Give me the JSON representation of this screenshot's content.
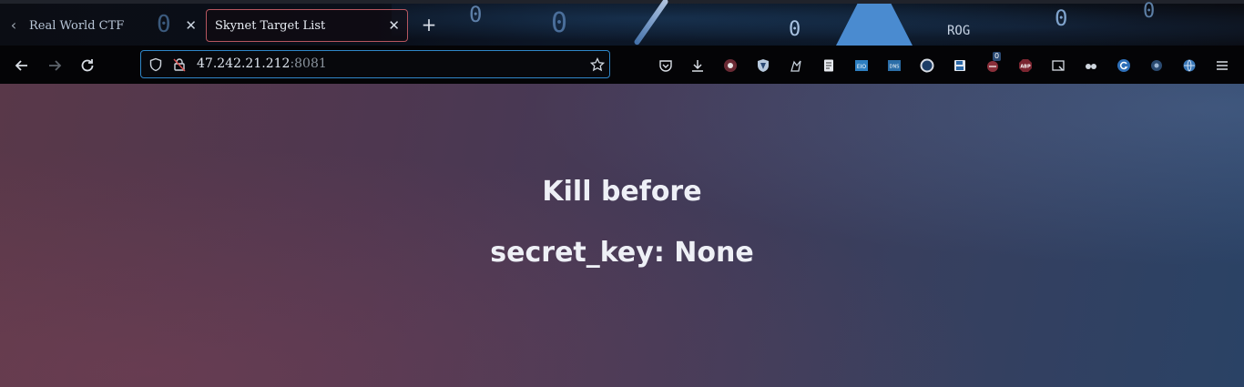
{
  "browser": {
    "tabs": [
      {
        "title": "Real World CTF",
        "active": false
      },
      {
        "title": "Skynet Target List",
        "active": true
      }
    ],
    "url": {
      "host": "47.242.21.212",
      "port": ":8081"
    },
    "toolbar_icons": [
      "pocket-icon",
      "download-icon",
      "extension-icon",
      "shield-extension-icon",
      "robot-extension-icon",
      "reader-extension-icon",
      "cookie-editor-icon",
      "dns-extension-icon",
      "circle-extension-icon",
      "save-extension-icon",
      "hackbar-icon",
      "adblock-plus-icon",
      "screenshot-icon",
      "glasses-icon",
      "grammarly-icon",
      "settings-extension-icon",
      "globe-extension-icon",
      "menu-icon"
    ],
    "badge_count": "0",
    "abp_label": "ABP",
    "dns_label": "DNS",
    "eio_label": "EIO"
  },
  "page": {
    "line1": "Kill before",
    "line2": "secret_key: None"
  },
  "colors": {
    "accent_border": "#2f86c8",
    "active_tab_border": "#b5565f",
    "bg_left": "#593849",
    "bg_right": "#2a4265"
  }
}
